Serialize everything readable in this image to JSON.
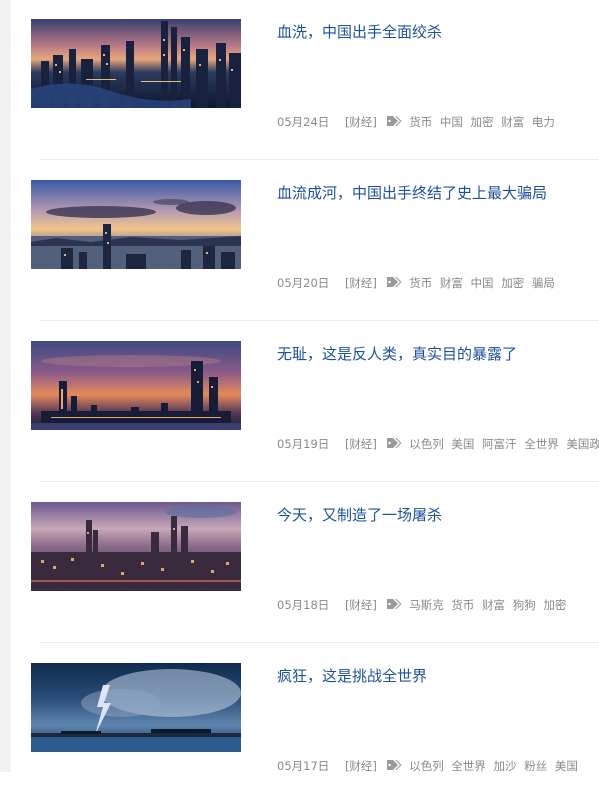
{
  "articles": [
    {
      "title": "血洗，中国出手全面绞杀",
      "date": "05月24日",
      "category": "[财经]",
      "tags": [
        "货币",
        "中国",
        "加密",
        "财富",
        "电力"
      ],
      "thumbnail": "night-city-river-skyline"
    },
    {
      "title": "血流成河，中国出手终结了史上最大骗局",
      "date": "05月20日",
      "category": "[财经]",
      "tags": [
        "货币",
        "财富",
        "中国",
        "加密",
        "骗局"
      ],
      "thumbnail": "harbor-skyline-dusk-clouds"
    },
    {
      "title": "无耻，这是反人类，真实目的暴露了",
      "date": "05月19日",
      "category": "[财经]",
      "tags": [
        "以色列",
        "美国",
        "阿富汗",
        "全世界",
        "美国政府"
      ],
      "thumbnail": "sunset-skyline-tall-towers"
    },
    {
      "title": "今天，又制造了一场屠杀",
      "date": "05月18日",
      "category": "[财经]",
      "tags": [
        "马斯克",
        "货币",
        "财富",
        "狗狗",
        "加密"
      ],
      "thumbnail": "aerial-city-dusk-purple-sky"
    },
    {
      "title": "疯狂，这是挑战全世界",
      "date": "05月17日",
      "category": "[财经]",
      "tags": [
        "以色列",
        "全世界",
        "加沙",
        "粉丝",
        "美国"
      ],
      "thumbnail": "lightning-storm-over-sea"
    }
  ],
  "colors": {
    "title_link": "#1e50a2",
    "meta_text": "#8a8a8a",
    "divider": "#ececec",
    "left_strip": "#f1f1f1"
  }
}
